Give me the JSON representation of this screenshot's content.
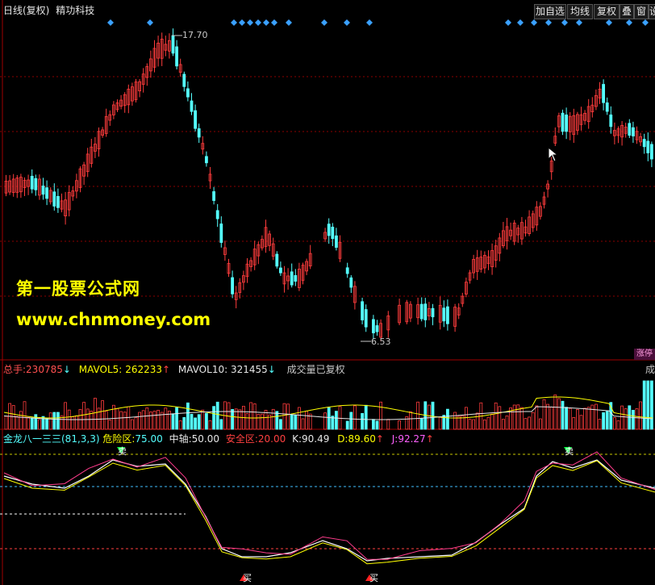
{
  "header": {
    "title": "日线(复权)",
    "stock_name": "精功科技"
  },
  "toolbar": [
    {
      "label": "加自选",
      "name": "add-watchlist-button"
    },
    {
      "label": "均线",
      "name": "ma-button"
    },
    {
      "label": "复权",
      "name": "fuquan-button"
    },
    {
      "label": "叠",
      "name": "overlay-button"
    },
    {
      "label": "窗",
      "name": "window-button"
    },
    {
      "label": "设",
      "name": "settings-button"
    }
  ],
  "price_panel": {
    "high_label": "17.70",
    "low_label": "6.53"
  },
  "watermark": {
    "line1": "第一股票公式网",
    "line2": "www.chnmoney.com"
  },
  "tag": {
    "zhangting": "涨停"
  },
  "volume_panel": {
    "total_label": "总手:",
    "total_value": "230785",
    "mavol5_label": "MAVOL5:",
    "mavol5_value": "262233",
    "mavol10_label": "MAVOL10:",
    "mavol10_value": "321455",
    "note": "成交量已复权",
    "right_cut": "成"
  },
  "indicator_panel": {
    "title": "金龙八一三三(81,3,3)",
    "danger_label": "危险区:",
    "danger_value": "75.00",
    "mid_label": "中轴:",
    "mid_value": "50.00",
    "safe_label": "安全区:",
    "safe_value": "20.00",
    "k_label": "K:",
    "k_value": "90.49",
    "d_label": "D:",
    "d_value": "89.60",
    "j_label": "J:",
    "j_value": "92.27",
    "sell_text": "卖",
    "buy_text": "买"
  },
  "colors": {
    "up": "#ff3c3c",
    "down": "#54ffff",
    "grid": "#8b0000",
    "yellow": "#ffff00",
    "bg": "#000000"
  }
}
